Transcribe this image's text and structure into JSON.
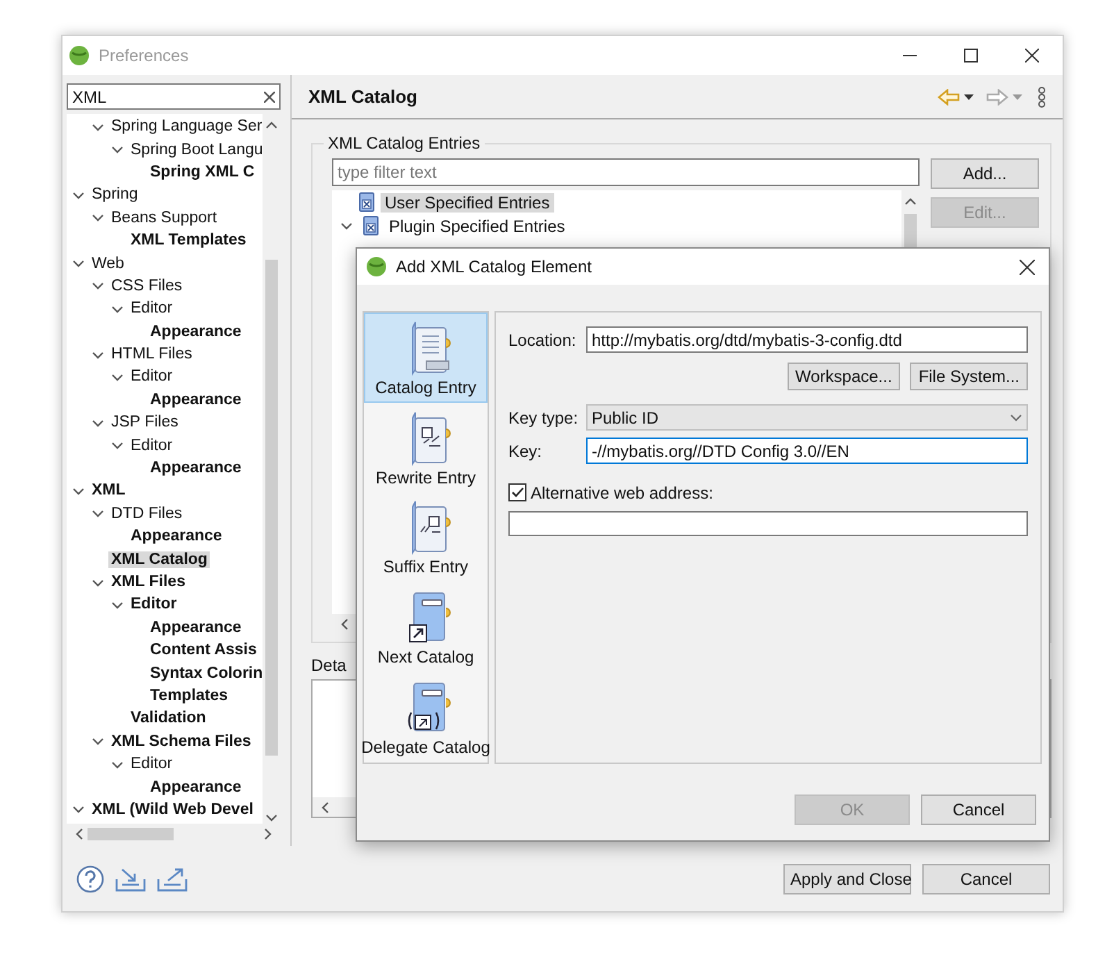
{
  "window": {
    "title": "Preferences"
  },
  "filter": {
    "value": "XML"
  },
  "tree": {
    "items": [
      {
        "children": [
          {
            "label": "Spring Language Ser",
            "bold": false,
            "selected": false,
            "expanded": true,
            "children": [
              {
                "label": "Spring Boot Langu",
                "bold": false,
                "selected": false,
                "expanded": true,
                "children": [
                  {
                    "label": "Spring XML C",
                    "bold": true,
                    "selected": false
                  }
                ]
              }
            ]
          }
        ]
      },
      {
        "label": "Spring",
        "bold": false,
        "selected": false,
        "expanded": true,
        "children": [
          {
            "label": "Beans Support",
            "bold": false,
            "selected": false,
            "expanded": true,
            "children": [
              {
                "label": "XML Templates",
                "bold": true,
                "selected": false
              }
            ]
          }
        ]
      },
      {
        "label": "Web",
        "bold": false,
        "selected": false,
        "expanded": true,
        "children": [
          {
            "label": "CSS Files",
            "bold": false,
            "selected": false,
            "expanded": true,
            "children": [
              {
                "label": "Editor",
                "bold": false,
                "selected": false,
                "expanded": true,
                "children": [
                  {
                    "label": "Appearance",
                    "bold": true,
                    "selected": false
                  }
                ]
              }
            ]
          },
          {
            "label": "HTML Files",
            "bold": false,
            "selected": false,
            "expanded": true,
            "children": [
              {
                "label": "Editor",
                "bold": false,
                "selected": false,
                "expanded": true,
                "children": [
                  {
                    "label": "Appearance",
                    "bold": true,
                    "selected": false
                  }
                ]
              }
            ]
          },
          {
            "label": "JSP Files",
            "bold": false,
            "selected": false,
            "expanded": true,
            "children": [
              {
                "label": "Editor",
                "bold": false,
                "selected": false,
                "expanded": true,
                "children": [
                  {
                    "label": "Appearance",
                    "bold": true,
                    "selected": false
                  }
                ]
              }
            ]
          }
        ]
      },
      {
        "label": "XML",
        "bold": true,
        "selected": false,
        "expanded": true,
        "children": [
          {
            "label": "DTD Files",
            "bold": false,
            "selected": false,
            "expanded": true,
            "children": [
              {
                "label": "Appearance",
                "bold": true,
                "selected": false
              }
            ]
          },
          {
            "label": "XML Catalog",
            "bold": true,
            "selected": true
          },
          {
            "label": "XML Files",
            "bold": true,
            "selected": false,
            "expanded": true,
            "children": [
              {
                "label": "Editor",
                "bold": true,
                "selected": false,
                "expanded": true,
                "children": [
                  {
                    "label": "Appearance",
                    "bold": true,
                    "selected": false
                  },
                  {
                    "label": "Content Assis",
                    "bold": true,
                    "selected": false
                  },
                  {
                    "label": "Syntax Colorin",
                    "bold": true,
                    "selected": false
                  },
                  {
                    "label": "Templates",
                    "bold": true,
                    "selected": false
                  }
                ]
              },
              {
                "label": "Validation",
                "bold": true,
                "selected": false
              }
            ]
          },
          {
            "label": "XML Schema Files",
            "bold": true,
            "selected": false,
            "expanded": true,
            "children": [
              {
                "label": "Editor",
                "bold": false,
                "selected": false,
                "expanded": true,
                "children": [
                  {
                    "label": "Appearance",
                    "bold": true,
                    "selected": false
                  }
                ]
              }
            ]
          }
        ]
      },
      {
        "label": "XML (Wild Web Devel",
        "bold": true,
        "selected": false,
        "expanded": true
      }
    ]
  },
  "page": {
    "title": "XML Catalog"
  },
  "catalog": {
    "group_label": "XML Catalog Entries",
    "filter": {
      "placeholder": "type filter text"
    },
    "entries": [
      {
        "label": "User Specified Entries",
        "selected": true
      },
      {
        "label": "Plugin Specified Entries",
        "selected": false,
        "expanded": true
      }
    ],
    "buttons": [
      {
        "label": "Add...",
        "disabled": false
      },
      {
        "label": "Edit...",
        "disabled": true
      }
    ],
    "details_label": "Deta"
  },
  "dialog": {
    "title": "Add XML Catalog Element",
    "palette": [
      {
        "label": "Catalog Entry",
        "kind": "list",
        "selected": true
      },
      {
        "label": "Rewrite Entry",
        "kind": "edit",
        "selected": false
      },
      {
        "label": "Suffix Entry",
        "kind": "suffix",
        "selected": false
      },
      {
        "label": "Next Catalog",
        "kind": "link",
        "selected": false
      },
      {
        "label": "Delegate Catalog",
        "kind": "delegate",
        "selected": false
      }
    ],
    "location": {
      "label": "Location:",
      "value": "http://mybatis.org/dtd/mybatis-3-config.dtd"
    },
    "location_buttons": [
      "Workspace...",
      "File System..."
    ],
    "key_type": {
      "label": "Key type:",
      "value": "Public ID"
    },
    "key": {
      "label": "Key:",
      "value": "-//mybatis.org//DTD Config 3.0//EN",
      "focused": true
    },
    "alt_address": {
      "label": "Alternative web address:",
      "checked": true
    },
    "buttons": [
      {
        "label": "OK",
        "disabled": true
      },
      {
        "label": "Cancel",
        "disabled": false
      }
    ]
  },
  "footer": {
    "buttons": [
      "Apply and Close",
      "Cancel"
    ]
  }
}
